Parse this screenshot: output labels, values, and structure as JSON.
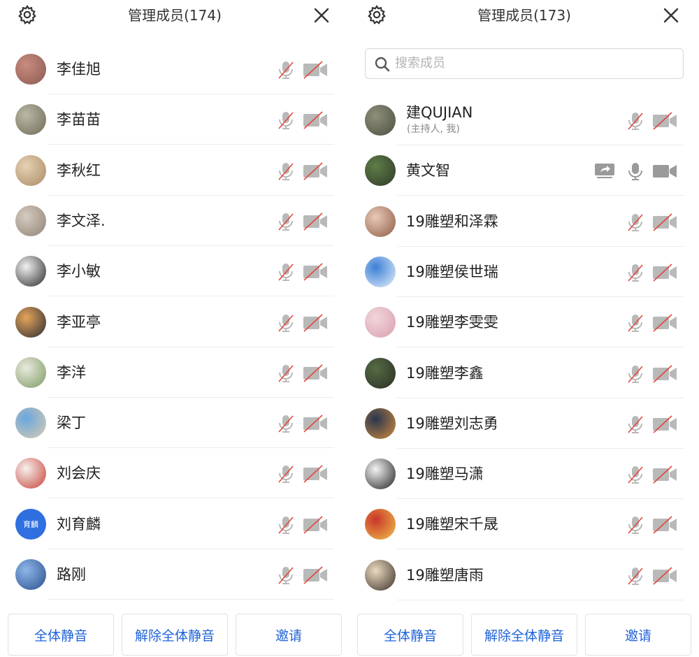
{
  "left_panel": {
    "title": "管理成员(174)",
    "members": [
      {
        "name": "李佳旭",
        "mic": "muted",
        "cam": "off",
        "avatar_colors": [
          "#c98b7e",
          "#8a5a52"
        ]
      },
      {
        "name": "李苗苗",
        "mic": "muted",
        "cam": "off",
        "avatar_colors": [
          "#b9b9a4",
          "#6f6a58"
        ]
      },
      {
        "name": "李秋红",
        "mic": "muted",
        "cam": "off",
        "avatar_colors": [
          "#e6d2b4",
          "#a98a63"
        ]
      },
      {
        "name": "李文泽.",
        "mic": "muted",
        "cam": "off",
        "avatar_colors": [
          "#d6cbbf",
          "#8f8275"
        ]
      },
      {
        "name": "李小敏",
        "mic": "muted",
        "cam": "off",
        "avatar_colors": [
          "#f1f1f1",
          "#2a2a2a"
        ]
      },
      {
        "name": "李亚亭",
        "mic": "muted",
        "cam": "off",
        "avatar_colors": [
          "#e5a55a",
          "#2b2a33"
        ]
      },
      {
        "name": "李洋",
        "mic": "muted",
        "cam": "off",
        "avatar_colors": [
          "#e9eadc",
          "#7b9a64"
        ]
      },
      {
        "name": "梁丁",
        "mic": "muted",
        "cam": "off",
        "avatar_colors": [
          "#6aa6df",
          "#d9ccb0"
        ]
      },
      {
        "name": "刘会庆",
        "mic": "muted",
        "cam": "off",
        "avatar_colors": [
          "#f6f1ec",
          "#c7403a"
        ]
      },
      {
        "name": "刘育麟",
        "mic": "muted",
        "cam": "off",
        "avatar_colors": [
          "#2f6fe0",
          "#2f6fe0"
        ],
        "avatar_text": "育麟"
      },
      {
        "name": "路刚",
        "mic": "muted",
        "cam": "off",
        "avatar_colors": [
          "#8eb6e8",
          "#2a4f8e"
        ]
      }
    ],
    "footer": {
      "mute_all": "全体静音",
      "unmute_all": "解除全体静音",
      "invite": "邀请"
    }
  },
  "right_panel": {
    "title": "管理成员(173)",
    "search_placeholder": "搜索成员",
    "members": [
      {
        "name": "建QUJIAN",
        "subtitle": "(主持人, 我)",
        "mic": "muted",
        "cam": "off",
        "avatar_colors": [
          "#8e8f7a",
          "#4d4f40"
        ]
      },
      {
        "name": "黄文智",
        "mic": "on",
        "cam": "on",
        "screen_share": true,
        "avatar_colors": [
          "#5f7d47",
          "#2f3a2a"
        ]
      },
      {
        "name": "19雕塑和泽霖",
        "mic": "muted",
        "cam": "off",
        "avatar_colors": [
          "#e8c9b7",
          "#8f5c45"
        ]
      },
      {
        "name": "19雕塑侯世瑞",
        "mic": "muted",
        "cam": "off",
        "avatar_colors": [
          "#3b7fd6",
          "#e8f1fb"
        ]
      },
      {
        "name": "19雕塑李雯雯",
        "mic": "muted",
        "cam": "off",
        "avatar_colors": [
          "#f2d6dc",
          "#d89fae"
        ]
      },
      {
        "name": "19雕塑李鑫",
        "mic": "muted",
        "cam": "off",
        "avatar_colors": [
          "#566b45",
          "#2a2f24"
        ]
      },
      {
        "name": "19雕塑刘志勇",
        "mic": "muted",
        "cam": "off",
        "avatar_colors": [
          "#28364e",
          "#d18b3e"
        ]
      },
      {
        "name": "19雕塑马潇",
        "mic": "muted",
        "cam": "off",
        "avatar_colors": [
          "#f3f3f3",
          "#222222"
        ]
      },
      {
        "name": "19雕塑宋千晟",
        "mic": "muted",
        "cam": "off",
        "avatar_colors": [
          "#c9352a",
          "#f0c24a"
        ]
      },
      {
        "name": "19雕塑唐雨",
        "mic": "muted",
        "cam": "off",
        "avatar_colors": [
          "#ecd9c0",
          "#3a3128"
        ]
      }
    ],
    "footer": {
      "mute_all": "全体静音",
      "unmute_all": "解除全体静音",
      "invite": "邀请"
    }
  },
  "colors": {
    "accent": "#1f63d8",
    "icon_gray": "#b9b9b9",
    "mute_red": "#e0483e",
    "icon_dark": "#9a9a9a"
  }
}
